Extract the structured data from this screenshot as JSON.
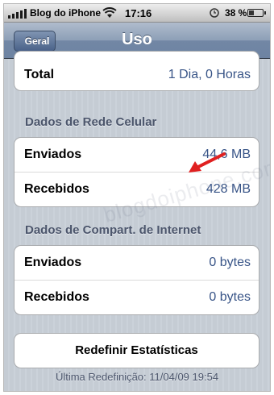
{
  "status_bar": {
    "carrier": "Blog do iPhone",
    "time": "17:16",
    "battery_percent": "38 %",
    "battery_level": 0.38,
    "icons": [
      "signal-icon",
      "wifi-icon",
      "clock-lock-icon",
      "battery-icon"
    ]
  },
  "nav": {
    "back_label": "Geral",
    "title": "Uso"
  },
  "total_row": {
    "label": "Total",
    "value": "1 Dia, 0 Horas"
  },
  "cellular": {
    "header": "Dados de Rede Celular",
    "rows": [
      {
        "label": "Enviados",
        "value": "44,6 MB"
      },
      {
        "label": "Recebidos",
        "value": "428 MB"
      }
    ]
  },
  "tethering": {
    "header": "Dados de Compart. de Internet",
    "rows": [
      {
        "label": "Enviados",
        "value": "0 bytes"
      },
      {
        "label": "Recebidos",
        "value": "0 bytes"
      }
    ]
  },
  "reset_button": "Redefinir Estatísticas",
  "last_reset": "Última Redefinição: 11/04/09 19:54",
  "watermark": "blogdoiphone.com",
  "colors": {
    "value_text": "#385487",
    "header_text": "#4c566c",
    "annotation_arrow": "#e02020"
  }
}
